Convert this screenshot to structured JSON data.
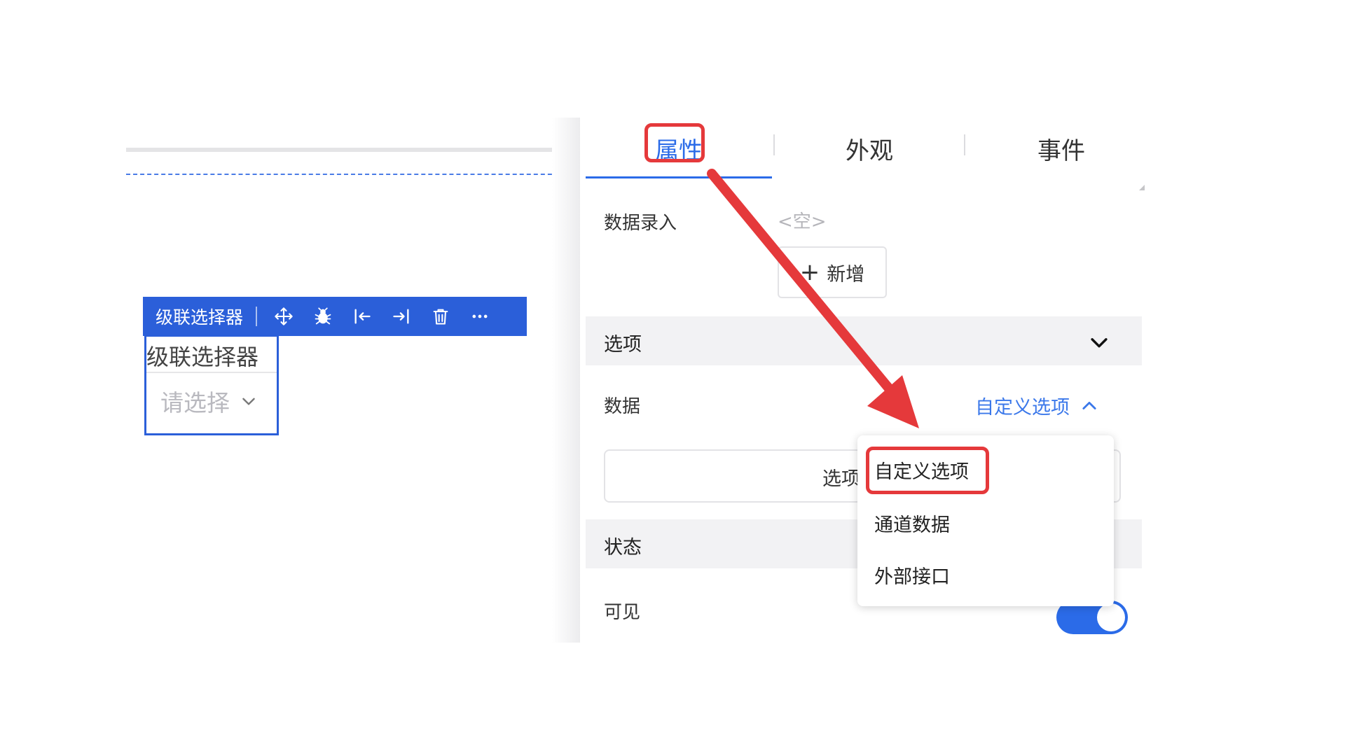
{
  "component_toolbar": {
    "title": "级联选择器",
    "icons": [
      "move-icon",
      "bug-icon",
      "align-left-icon",
      "align-right-icon",
      "trash-icon",
      "more-icon"
    ]
  },
  "component": {
    "label": "级联选择器",
    "placeholder": "请选择"
  },
  "tabs": [
    {
      "label": "属性",
      "active": true
    },
    {
      "label": "外观",
      "active": false
    },
    {
      "label": "事件",
      "active": false
    }
  ],
  "data_entry": {
    "label": "数据录入",
    "value": "<空>",
    "add_label": "新增"
  },
  "options_section": {
    "title": "选项",
    "data_label": "数据",
    "data_source": "自定义选项",
    "options_button": "选项"
  },
  "dropdown": {
    "items": [
      "自定义选项",
      "通道数据",
      "外部接口"
    ],
    "highlighted_index": 0
  },
  "status_section": {
    "title": "状态",
    "visible_label": "可见",
    "visible_on": true
  },
  "colors": {
    "accent": "#2b6be8",
    "toolbar": "#2b5fd9",
    "annotation": "#e5393b"
  }
}
